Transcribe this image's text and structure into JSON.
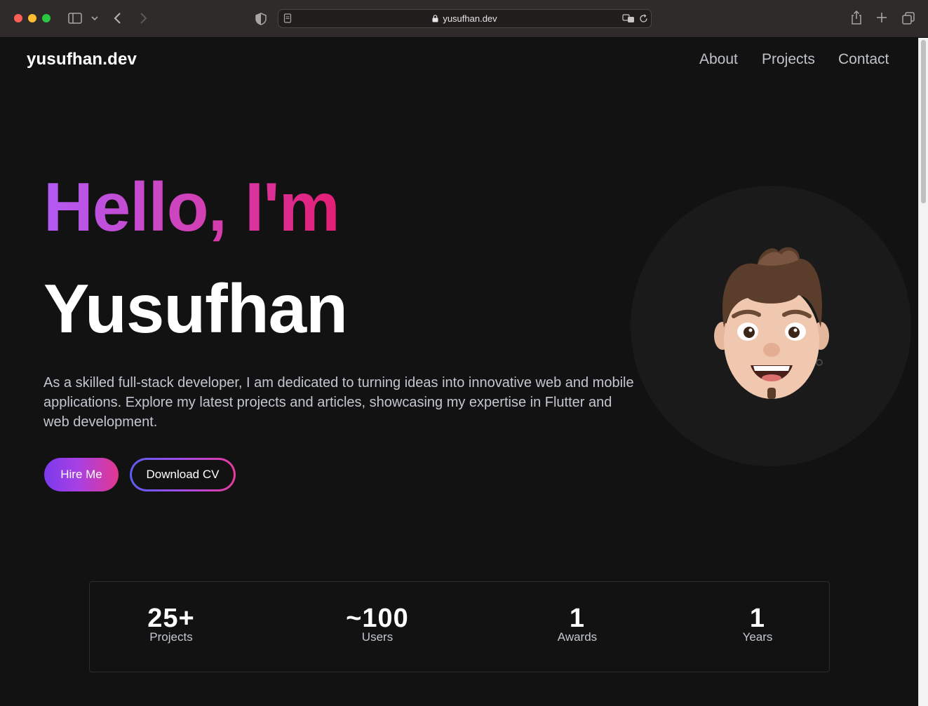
{
  "browser": {
    "url": "yusufhan.dev",
    "icons": [
      "sidebar-icon",
      "chevron-down-icon",
      "back-icon",
      "forward-icon",
      "shield-icon",
      "page-icon",
      "lock-icon",
      "translate-icon",
      "reload-icon",
      "share-icon",
      "new-tab-icon",
      "tabs-icon"
    ]
  },
  "header": {
    "logo": "yusufhan.dev",
    "nav": [
      "About",
      "Projects",
      "Contact"
    ]
  },
  "hero": {
    "greeting": "Hello, I'm",
    "name": "Yusufhan",
    "intro": "As a skilled full-stack developer, I am dedicated to turning ideas into innovative web and mobile applications. Explore my latest projects and articles, showcasing my expertise in Flutter and web development.",
    "primary_button": "Hire Me",
    "secondary_button": "Download CV",
    "gradient_colors": [
      "#b35af5",
      "#d33fb2",
      "#e41e74"
    ]
  },
  "stats": [
    {
      "value": "25+",
      "label": "Projects"
    },
    {
      "value": "~100",
      "label": "Users"
    },
    {
      "value": "1",
      "label": "Awards"
    },
    {
      "value": "1",
      "label": "Years"
    }
  ],
  "colors": {
    "background": "#121212",
    "text": "#ffffff",
    "muted_text": "#c3c7cf",
    "accent_purple": "#7c3aed",
    "accent_pink": "#e2378f"
  }
}
